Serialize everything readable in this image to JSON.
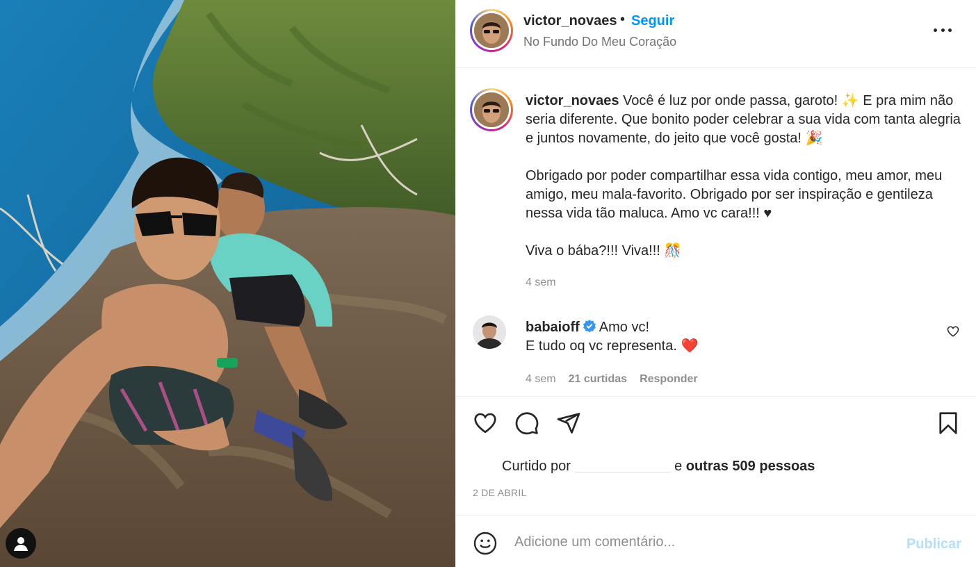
{
  "post": {
    "author": "victor_novaes",
    "follow_label": "Seguir",
    "separator": "•",
    "location": "No Fundo Do Meu Coração",
    "more_icon": "more-horizontal-icon"
  },
  "caption": {
    "username": "victor_novaes",
    "text": " Você é luz por onde passa, garoto! ✨ E pra mim não seria diferente. Que bonito poder celebrar a sua vida com tanta alegria e juntos novamente, do jeito que você gosta! 🎉\n\nObrigado por poder compartilhar essa vida contigo, meu amor, meu amigo, meu mala-favorito. Obrigado por ser inspiração e gentileza nessa vida tão maluca. Amo vc cara!!! ♥\n\nViva o bába?!!! Viva!!! 🎊",
    "time": "4 sem"
  },
  "comment": {
    "username": "babaioff",
    "text": "Amo vc!\nE tudo oq vc representa. ❤️",
    "time": "4 sem",
    "likes": "21 curtidas",
    "reply": "Responder"
  },
  "likes": {
    "prefix": "Curtido por",
    "connector": "e",
    "others": "outras 509 pessoas"
  },
  "date": "2 DE ABRIL",
  "add_comment": {
    "placeholder": "Adicione um comentário...",
    "publish": "Publicar"
  },
  "colors": {
    "link_blue": "#0095f6",
    "publish_disabled": "#b2dffc",
    "muted": "#8e8e8e",
    "text": "#262626"
  }
}
